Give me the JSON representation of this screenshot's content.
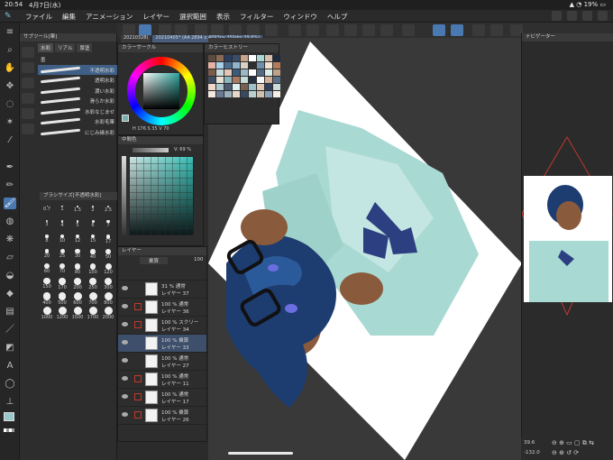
{
  "status_bar": {
    "time": "20:54",
    "date": "4月7日(水)",
    "battery": "19%"
  },
  "menu": {
    "items": [
      "ファイル",
      "編集",
      "アニメーション",
      "レイヤー",
      "選択範囲",
      "表示",
      "フィルター",
      "ウィンドウ",
      "ヘルプ"
    ]
  },
  "tabs": {
    "doc1": "20210328(",
    "doc2": "20210405* (A4 2894 x 4093px 350dpi 39.6%)"
  },
  "subtool": {
    "title": "サブツール[筆]",
    "tabs": [
      "水彩",
      "リアル",
      "厚塗"
    ],
    "group": "墨",
    "brushes": [
      {
        "label": "不透明水彩",
        "selected": true
      },
      {
        "label": "透明水彩",
        "selected": false
      },
      {
        "label": "濃い水彩",
        "selected": false
      },
      {
        "label": "滑らか水彩",
        "selected": false
      },
      {
        "label": "水彩なじませ",
        "selected": false
      },
      {
        "label": "水彩毛筆",
        "selected": false
      },
      {
        "label": "にじみ縁水彩",
        "selected": false
      }
    ],
    "size_title": "ブラシサイズ[不透明水彩]",
    "sizes": [
      "0.7",
      "1",
      "1.5",
      "2",
      "2.5",
      "3",
      "4",
      "5",
      "6",
      "7",
      "8",
      "10",
      "12",
      "15",
      "17",
      "20",
      "25",
      "30",
      "40",
      "50",
      "60",
      "70",
      "80",
      "100",
      "120",
      "150",
      "170",
      "200",
      "250",
      "300",
      "400",
      "500",
      "600",
      "700",
      "800",
      "1000",
      "1200",
      "1500",
      "1700",
      "2000"
    ]
  },
  "colorwheel": {
    "title": "カラーサークル",
    "h": "176",
    "s": "35",
    "v": "70",
    "wheel_colors": [
      "#ff0000",
      "#ffff00",
      "#00ff00",
      "#00ffff",
      "#0000ff",
      "#ff00ff"
    ],
    "current_color": "#7ab0ad"
  },
  "history": {
    "title": "カラーヒストリー",
    "swatches": [
      "#5b4a3e",
      "#8a6a55",
      "#2a3d5c",
      "#3b4c6a",
      "#c9a38a",
      "#ffffff",
      "#a9d8d5",
      "#d7c0b0",
      "#1f2a40",
      "#e7b2a4",
      "#aad0e8",
      "#4d6d8f",
      "#8fb5cc",
      "#d9d0c8",
      "#2e2e2e",
      "#6f8fa8",
      "#f0e0d0",
      "#b47a5a",
      "#7a5a48",
      "#c6dcdc",
      "#e2c7b7",
      "#3c5a7a",
      "#9bb8c8",
      "#ffffff",
      "#546b82",
      "#d8ece9",
      "#bfa08a",
      "#404d60",
      "#e9e0d6",
      "#8ab8c0",
      "#a87a62",
      "#c8dcd8",
      "#263040",
      "#fafafa",
      "#d0b098",
      "#5a7088",
      "#efd8c8",
      "#b0c8d0",
      "#4a5a70",
      "#e0f0ee",
      "#786050",
      "#a0c0c8",
      "#dec8b8",
      "#30405a",
      "#ccdcdc",
      "#f5e8e0",
      "#6a7a90",
      "#98b0c0",
      "#e8d8cc",
      "#384860",
      "#b8d0d0",
      "#d0c0b0",
      "#8aa0b8",
      "#f8f0e8"
    ]
  },
  "colorset": {
    "title": "中間色",
    "percent": "V: 69 %"
  },
  "layers": {
    "title": "レイヤー",
    "blend": "乗算",
    "opacity": "100",
    "rows": [
      {
        "line1": "31 % 通常",
        "line2": "レイヤー 37",
        "selected": false,
        "marked": false
      },
      {
        "line1": "100 % 通常",
        "line2": "レイヤー 36",
        "selected": false,
        "marked": true
      },
      {
        "line1": "100 % スクリー",
        "line2": "レイヤー 34",
        "selected": false,
        "marked": true
      },
      {
        "line1": "100 % 乗算",
        "line2": "レイヤー 33",
        "selected": true,
        "marked": false
      },
      {
        "line1": "100 % 通常",
        "line2": "レイヤー 27",
        "selected": false,
        "marked": false
      },
      {
        "line1": "100 % 通常",
        "line2": "レイヤー 11",
        "selected": false,
        "marked": true
      },
      {
        "line1": "100 % 通常",
        "line2": "レイヤー 17",
        "selected": false,
        "marked": true
      },
      {
        "line1": "100 % 乗算",
        "line2": "レイヤー 26",
        "selected": false,
        "marked": true
      }
    ]
  },
  "navigator": {
    "title": "ナビゲーター",
    "zoom": "39.6",
    "rotation": "-132.0"
  }
}
